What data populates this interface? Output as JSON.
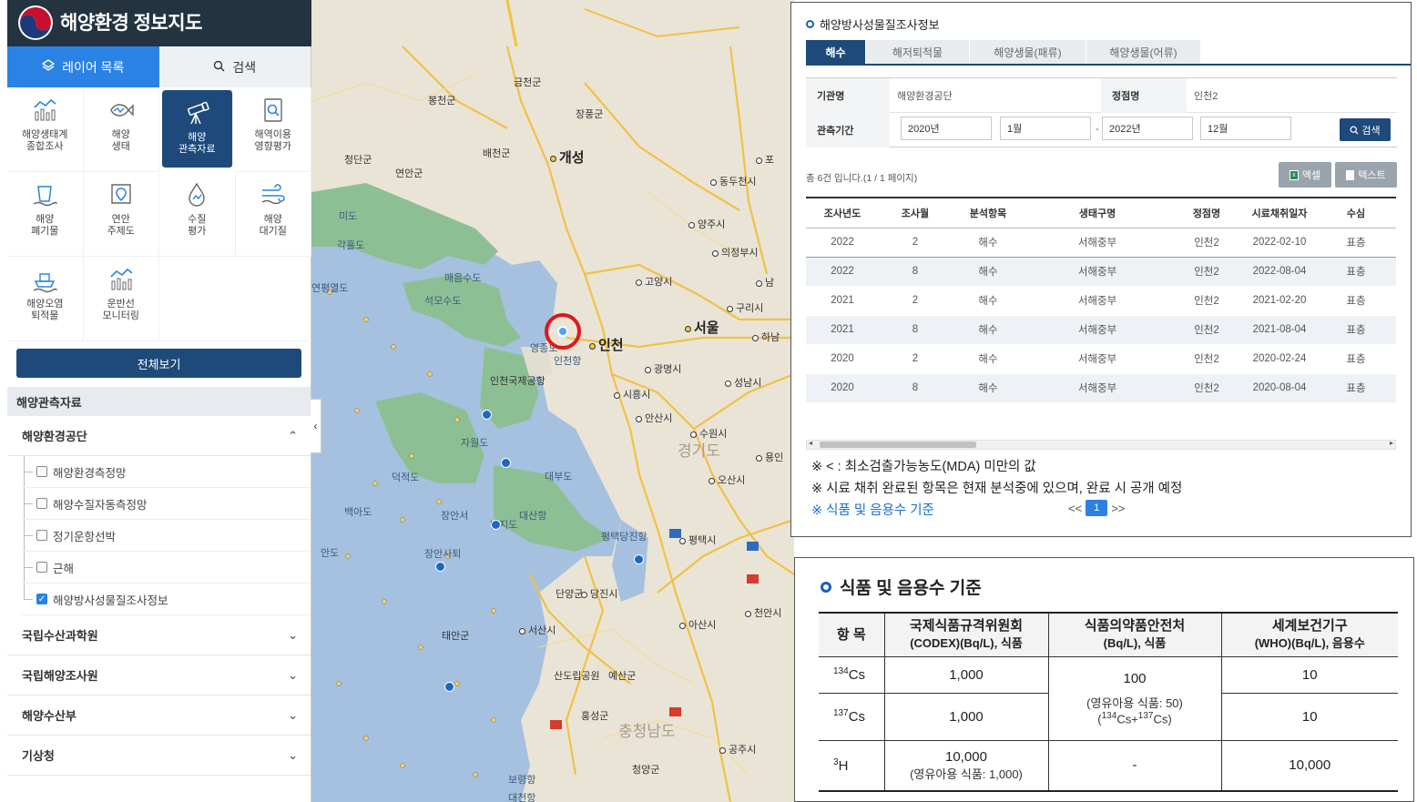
{
  "app": {
    "title": "해양환경 정보지도"
  },
  "panel": {
    "tabs": [
      {
        "label": "레이어 목록",
        "icon": "layers-icon"
      },
      {
        "label": "검색",
        "icon": "search-icon"
      }
    ],
    "grid": [
      {
        "l1": "해양생태계",
        "l2": "종합조사",
        "icon": "ecosystem-chart-icon"
      },
      {
        "l1": "해양",
        "l2": "생태",
        "icon": "fish-icon"
      },
      {
        "l1": "해양",
        "l2": "관측자료",
        "icon": "telescope-icon"
      },
      {
        "l1": "해역이용",
        "l2": "영향평가",
        "icon": "document-search-icon"
      },
      {
        "l1": "해양",
        "l2": "폐기물",
        "icon": "waste-icon"
      },
      {
        "l1": "연안",
        "l2": "주제도",
        "icon": "map-pin-icon"
      },
      {
        "l1": "수질",
        "l2": "평가",
        "icon": "water-drop-icon"
      },
      {
        "l1": "해양",
        "l2": "대기질",
        "icon": "wind-icon"
      },
      {
        "l1": "해양오염",
        "l2": "퇴적물",
        "icon": "ship-icon"
      },
      {
        "l1": "운반선",
        "l2": "모니터링",
        "icon": "monitoring-chart-icon"
      }
    ],
    "all_button": "전체보기",
    "section": "해양관측자료",
    "orgs": [
      {
        "label": "해양환경공단",
        "expanded": true
      },
      {
        "label": "국립수산과학원"
      },
      {
        "label": "국립해양조사원"
      },
      {
        "label": "해양수산부"
      },
      {
        "label": "기상청"
      }
    ],
    "sublayers": [
      {
        "label": "해양환경측정망",
        "checked": false
      },
      {
        "label": "해양수질자동측정망",
        "checked": false
      },
      {
        "label": "정기운항선박",
        "checked": false
      },
      {
        "label": "근해",
        "checked": false
      },
      {
        "label": "해양방사성물질조사정보",
        "checked": true
      }
    ]
  },
  "map": {
    "labels": [
      {
        "t": "금천군"
      },
      {
        "t": "봉천군"
      },
      {
        "t": "장풍군"
      },
      {
        "t": "배천군"
      },
      {
        "t": "청단군"
      },
      {
        "t": "연안군"
      },
      {
        "t": "개성"
      },
      {
        "t": "동두천시"
      },
      {
        "t": "포"
      },
      {
        "t": "양주시"
      },
      {
        "t": "의정부시"
      },
      {
        "t": "고양시"
      },
      {
        "t": "남"
      },
      {
        "t": "구리시"
      },
      {
        "t": "서울"
      },
      {
        "t": "하남"
      },
      {
        "t": "인천"
      },
      {
        "t": "광명시"
      },
      {
        "t": "성남시"
      },
      {
        "t": "시흥시"
      },
      {
        "t": "안산시"
      },
      {
        "t": "수원시"
      },
      {
        "t": "경기도"
      },
      {
        "t": "용인"
      },
      {
        "t": "오산시"
      },
      {
        "t": "평택시"
      },
      {
        "t": "당진시"
      },
      {
        "t": "천안시"
      },
      {
        "t": "아산시"
      },
      {
        "t": "서산시"
      },
      {
        "t": "태안군"
      },
      {
        "t": "예산군"
      },
      {
        "t": "홍성군"
      },
      {
        "t": "충청남도"
      },
      {
        "t": "공주시"
      },
      {
        "t": "청양군"
      },
      {
        "t": "보령항"
      },
      {
        "t": "대천항"
      },
      {
        "t": "인천국제공항"
      },
      {
        "t": "영종도"
      },
      {
        "t": "석모수도"
      },
      {
        "t": "매음수도"
      },
      {
        "t": "연평열도"
      },
      {
        "t": "장안서"
      },
      {
        "t": "대산항"
      },
      {
        "t": "장안사퇴"
      },
      {
        "t": "평택당진항"
      },
      {
        "t": "산도립공원"
      },
      {
        "t": "단양군"
      },
      {
        "t": "인천항"
      },
      {
        "t": "난지도"
      },
      {
        "t": "덕적도"
      },
      {
        "t": "자월도"
      },
      {
        "t": "백아도"
      },
      {
        "t": "각흘도"
      },
      {
        "t": "미도"
      },
      {
        "t": "대부도"
      },
      {
        "t": "안도"
      }
    ]
  },
  "survey": {
    "title": "해양방사성물질조사정보",
    "tabs": [
      "해수",
      "해저퇴적물",
      "해양생물(패류)",
      "해양생물(어류)"
    ],
    "form": {
      "org_label": "기관명",
      "org_value": "해양환경공단",
      "station_label": "정점명",
      "station_value": "인천2",
      "period_label": "관측기간",
      "from_year": "2020년",
      "from_month": "1월",
      "sep": "-",
      "to_year": "2022년",
      "to_month": "12월",
      "search_button": "검색"
    },
    "count_text": "총 6건 입니다.(1 / 1 페이지)",
    "excel_button": "엑셀",
    "text_button": "텍스트",
    "columns": [
      "조사년도",
      "조사월",
      "분석항목",
      "생태구명",
      "정점명",
      "시료채취일자",
      "수심"
    ],
    "rows": [
      [
        "2022",
        "2",
        "해수",
        "서해중부",
        "인천2",
        "2022-02-10",
        "표층"
      ],
      [
        "2022",
        "8",
        "해수",
        "서해중부",
        "인천2",
        "2022-08-04",
        "표층"
      ],
      [
        "2021",
        "2",
        "해수",
        "서해중부",
        "인천2",
        "2021-02-20",
        "표층"
      ],
      [
        "2021",
        "8",
        "해수",
        "서해중부",
        "인천2",
        "2021-08-04",
        "표층"
      ],
      [
        "2020",
        "2",
        "해수",
        "서해중부",
        "인천2",
        "2020-02-24",
        "표층"
      ],
      [
        "2020",
        "8",
        "해수",
        "서해중부",
        "인천2",
        "2020-08-04",
        "표층"
      ]
    ],
    "notes": [
      "※ < : 최소검출가능농도(MDA) 미만의 값",
      "※ 시료 채취 완료된 항목은 현재 분석중에 있으며, 완료 시 공개 예정"
    ],
    "link": "※ 식품 및 음용수 기준",
    "pager": {
      "prev": "<<",
      "page": "1",
      "next": ">>"
    }
  },
  "standards": {
    "title": "식품 및 음용수 기준",
    "headers": {
      "item": "항 목",
      "codex_1": "국제식품규격위원회",
      "codex_2": "(CODEX)(Bq/L), 식품",
      "mfds_1": "식품의약품안전처",
      "mfds_2": "(Bq/L), 식품",
      "who_1": "세계보건기구",
      "who_2": "(WHO)(Bq/L), 음용수"
    },
    "rows": {
      "cs134": {
        "mass": "134",
        "el": "Cs",
        "codex": "1,000",
        "who": "10"
      },
      "cs137": {
        "mass": "137",
        "el": "Cs",
        "codex": "1,000",
        "who": "10"
      },
      "h3": {
        "mass": "3",
        "el": "H",
        "codex": "10,000",
        "codex_note": "(영유아용 식품: 1,000)",
        "mfds": "-",
        "who": "10,000"
      },
      "mfds_cs": "100",
      "mfds_cs_note1": "(영유아용 식품: 50)",
      "mfds_cs_note2_a": "(",
      "mfds_cs_note2_m1": "134",
      "mfds_cs_note2_b": "Cs+",
      "mfds_cs_note2_m2": "137",
      "mfds_cs_note2_c": "Cs)"
    }
  }
}
